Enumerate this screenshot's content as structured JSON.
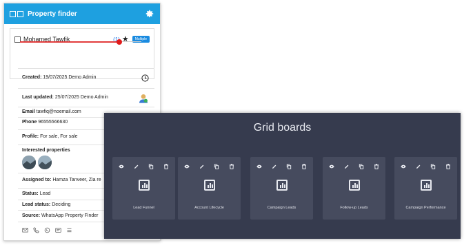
{
  "card": {
    "title": "Property finder",
    "contact_name": "Mohamed Tawfik",
    "contact_count": "(1)",
    "multiple_label": "Multiple",
    "slider_level": 0.82,
    "created": {
      "label": "Created:",
      "value": "19/07/2025 Demo Admin"
    },
    "last_updated": {
      "label": "Last updated:",
      "value": "25/07/2025 Demo Admin"
    },
    "email": {
      "label": "Email",
      "value": "tawfiq@noemail.com"
    },
    "phone": {
      "label": "Phone",
      "value": "96555566630"
    },
    "profile": {
      "label": "Profile:",
      "value": "For sale, For sale"
    },
    "interested": {
      "label": "Interested properties"
    },
    "assigned": {
      "label": "Assigned to:",
      "value": "Hamza Tanveer, Zia re"
    },
    "status": {
      "label": "Status:",
      "value": "Lead"
    },
    "lead_status": {
      "label": "Lead status:",
      "value": "Deciding"
    },
    "source": {
      "label": "Source:",
      "value": "WhatsApp Property Finder"
    },
    "accent": "#1ea0e0"
  },
  "grid": {
    "title": "Grid boards",
    "boards": [
      {
        "label": "Lead Funnel"
      },
      {
        "label": "Account Lifecycle"
      },
      {
        "label": "Campaign Leads"
      },
      {
        "label": "Follow-up Leads"
      },
      {
        "label": "Campaign Performance"
      }
    ],
    "background": "#363b4e"
  }
}
